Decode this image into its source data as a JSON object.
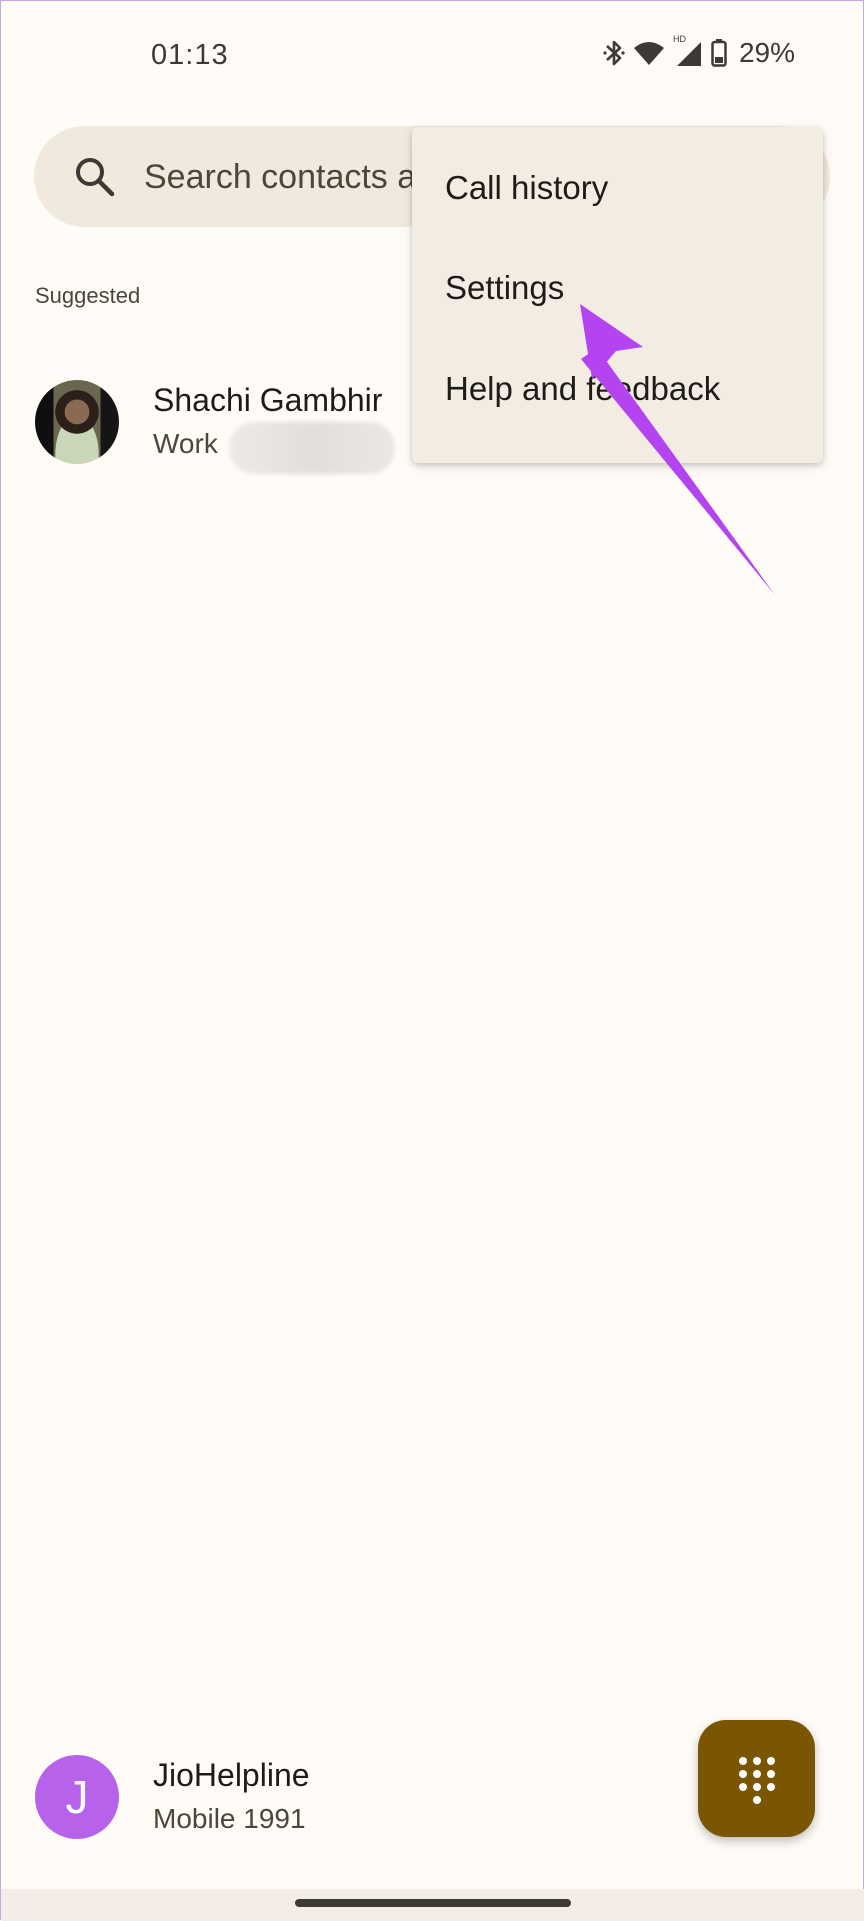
{
  "status_bar": {
    "time": "01:13",
    "battery_percent": "29%",
    "network_badge": "HD",
    "icons": [
      "bluetooth-icon",
      "wifi-icon",
      "cell-signal-icon",
      "battery-icon"
    ]
  },
  "search": {
    "placeholder": "Search contacts a",
    "icon": "search-icon"
  },
  "suggested": {
    "section_label": "Suggested",
    "contacts": [
      {
        "name": "Shachi Gambhir",
        "type": "Work"
      }
    ]
  },
  "bottom_contact": {
    "name": "JioHelpline",
    "detail": "Mobile 1991",
    "avatar_letter": "J",
    "avatar_color": "#b662ea"
  },
  "overflow_menu": {
    "items": [
      {
        "label": "Call history"
      },
      {
        "label": "Settings"
      },
      {
        "label": "Help and feedback"
      }
    ]
  },
  "annotation": {
    "type": "arrow",
    "points_to": "Settings",
    "color": "#b444f0"
  },
  "fab": {
    "icon": "dialpad-icon",
    "color": "#7a5502"
  }
}
